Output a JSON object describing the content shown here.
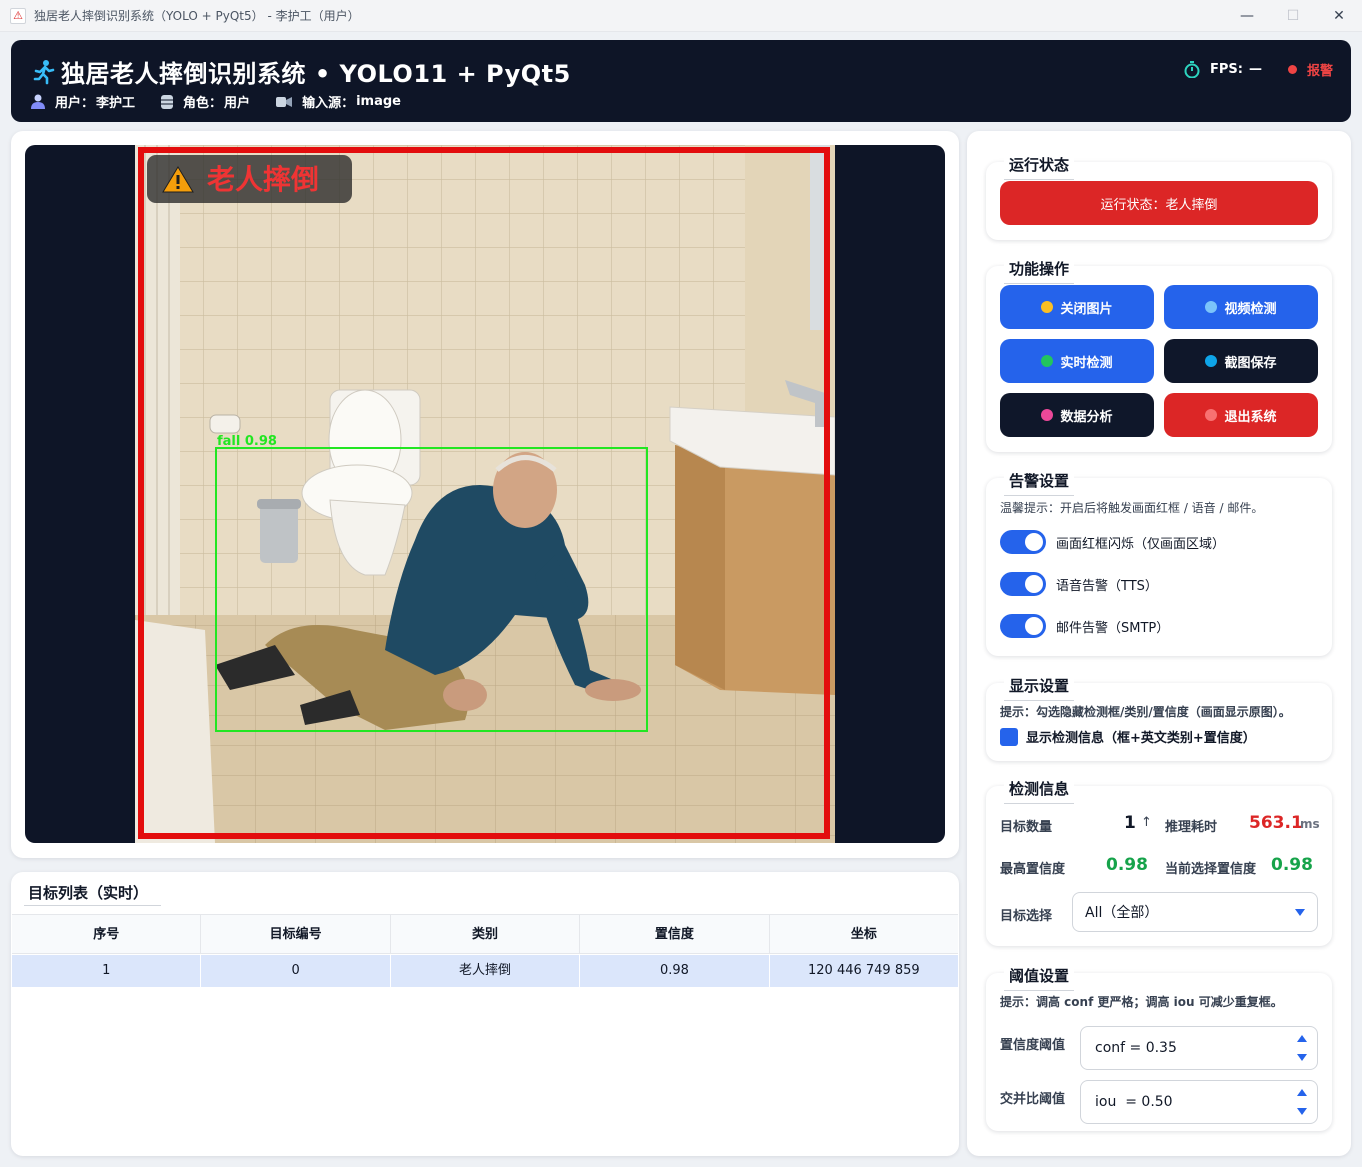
{
  "window": {
    "title": "独居老人摔倒识别系统（YOLO + PyQt5） - 李护工（用户）",
    "minimize_glyph": "—",
    "maximize_glyph": "☐",
    "close_glyph": "✕"
  },
  "header": {
    "title": "独居老人摔倒识别系统 • YOLO11 + PyQt5",
    "user_label": "用户：",
    "user_value": "李护工",
    "role_label": "角色：",
    "role_value": "用户",
    "source_label": "输入源：",
    "source_value": "image",
    "fps_label": "FPS:",
    "fps_value": "—",
    "alarm_label": "报警"
  },
  "viewer": {
    "warning_text": "老人摔倒",
    "detection_label": "fall 0.98"
  },
  "target_list": {
    "title": "目标列表（实时）",
    "columns": [
      "序号",
      "目标编号",
      "类别",
      "置信度",
      "坐标"
    ],
    "rows": [
      [
        "1",
        "0",
        "老人摔倒",
        "0.98",
        "120 446 749 859"
      ]
    ]
  },
  "status": {
    "title": "运行状态",
    "button_label": "运行状态：老人摔倒"
  },
  "operations": {
    "title": "功能操作",
    "buttons": [
      {
        "label": "关闭图片",
        "bg": "#2563eb",
        "dot": "#fbbf24"
      },
      {
        "label": "视频检测",
        "bg": "#2563eb",
        "dot": "#7cc4fa"
      },
      {
        "label": "实时检测",
        "bg": "#2563eb",
        "dot": "#22c55e"
      },
      {
        "label": "截图保存",
        "bg": "#0f172a",
        "dot": "#0ea5e9"
      },
      {
        "label": "数据分析",
        "bg": "#0f172a",
        "dot": "#ec4899"
      },
      {
        "label": "退出系统",
        "bg": "#dc2626",
        "dot": "#f87171"
      }
    ]
  },
  "alert_settings": {
    "title": "告警设置",
    "hint": "温馨提示：开启后将触发画面红框 / 语音 / 邮件。",
    "toggles": [
      {
        "label": "画面红框闪烁（仅画面区域）",
        "on": true
      },
      {
        "label": "语音告警（TTS）",
        "on": true
      },
      {
        "label": "邮件告警（SMTP）",
        "on": true
      }
    ]
  },
  "display_settings": {
    "title": "显示设置",
    "hint": "提示：勾选隐藏检测框/类别/置信度（画面显示原图）。",
    "checkbox_label": "显示检测信息（框+英文类别+置信度）"
  },
  "detection_info": {
    "title": "检测信息",
    "count_label": "目标数量",
    "count_value": "1",
    "count_arrow": "↑",
    "time_label": "推理耗时",
    "time_value": "563.1",
    "time_unit": "ms",
    "max_conf_label": "最高置信度",
    "max_conf_value": "0.98",
    "cur_conf_label": "当前选择置信度",
    "cur_conf_value": "0.98",
    "select_label": "目标选择",
    "select_value": "All（全部）"
  },
  "threshold": {
    "title": "阈值设置",
    "hint": "提示：调高 conf 更严格；调高 iou 可减少重复框。",
    "conf_label": "置信度阈值",
    "conf_value": "conf = 0.35",
    "iou_label": "交并比阈值",
    "iou_value": "iou  = 0.50"
  },
  "colors": {
    "header_bg": "#0e1527",
    "primary": "#2563eb",
    "danger": "#dc2626",
    "dark": "#0f172a",
    "success": "#16a34a"
  }
}
